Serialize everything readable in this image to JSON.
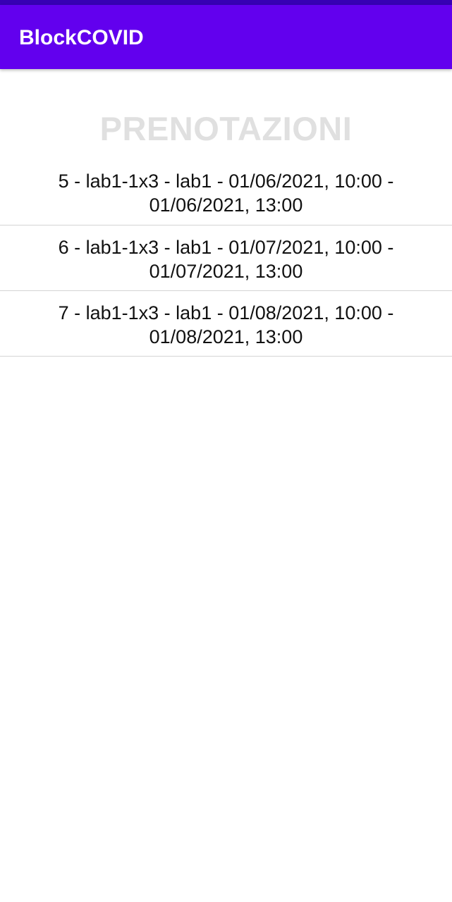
{
  "app": {
    "title": "BlockCOVID",
    "colors": {
      "status_bar": "#3700B3",
      "app_bar": "#6200EE",
      "heading": "#E0E0E0"
    }
  },
  "main": {
    "heading": "PRENOTAZIONI",
    "bookings": [
      {
        "line1": "5 - lab1-1x3 - lab1 - 01/06/2021, 10:00 -",
        "line2": "01/06/2021, 13:00"
      },
      {
        "line1": "6 - lab1-1x3 - lab1 - 01/07/2021, 10:00 -",
        "line2": "01/07/2021, 13:00"
      },
      {
        "line1": "7 - lab1-1x3 - lab1 - 01/08/2021, 10:00 -",
        "line2": "01/08/2021, 13:00"
      }
    ]
  }
}
